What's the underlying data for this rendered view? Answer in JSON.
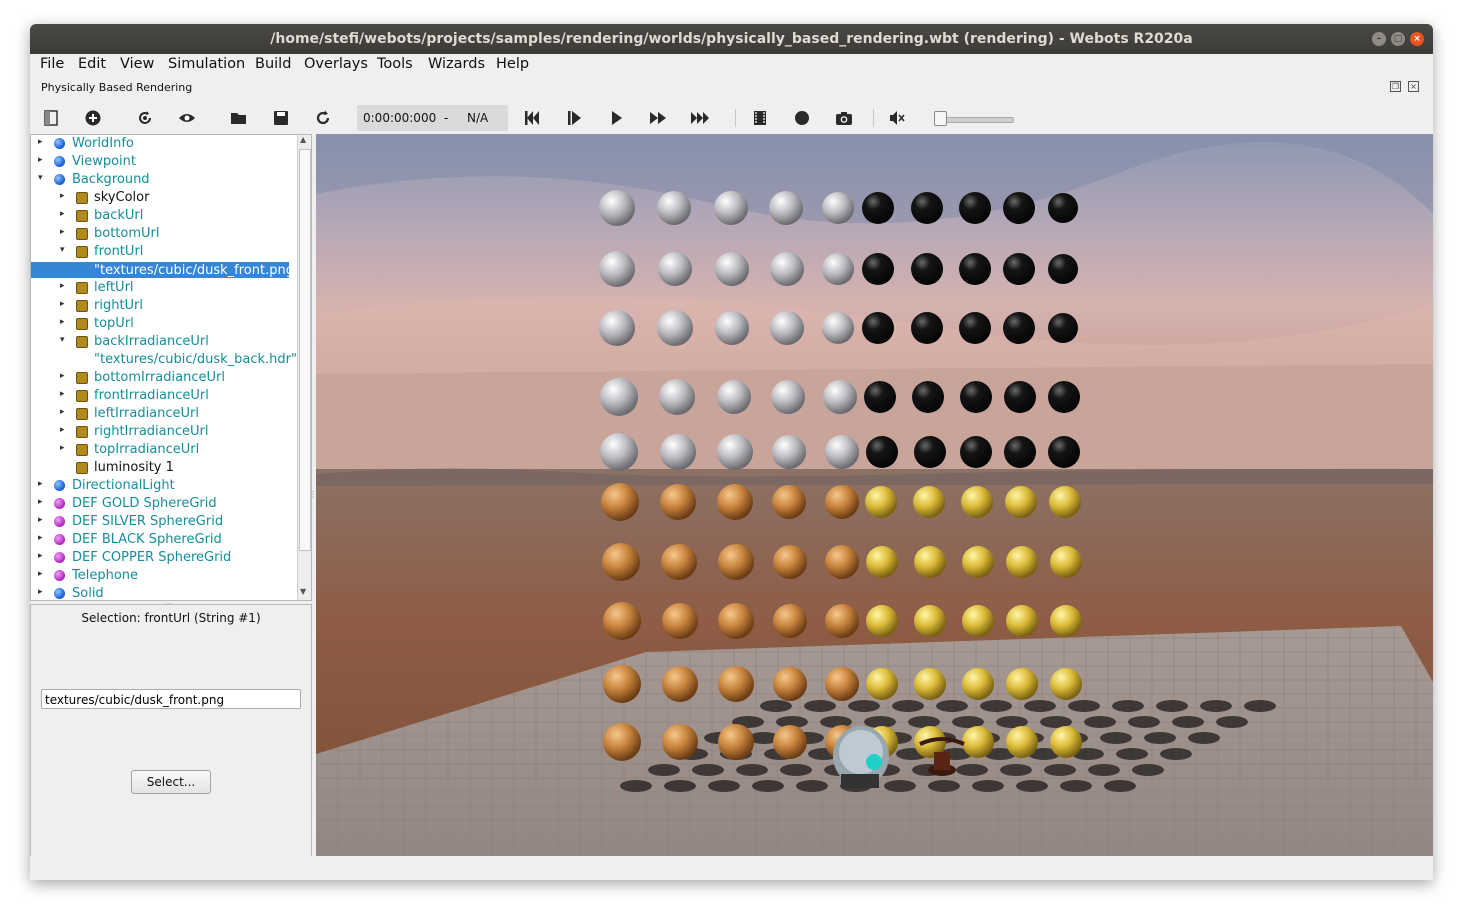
{
  "window": {
    "title": "/home/stefi/webots/projects/samples/rendering/worlds/physically_based_rendering.wbt (rendering) - Webots R2020a"
  },
  "menu": [
    "File",
    "Edit",
    "View",
    "Simulation",
    "Build",
    "Overlays",
    "Tools",
    "Wizards",
    "Help"
  ],
  "dock": {
    "title": "Physically Based Rendering"
  },
  "toolbar": {
    "time": "0:00:00:000",
    "separator": "-",
    "speed": "N/A",
    "volume": 0.05,
    "icons": [
      "scene-tree-toggle-icon",
      "add-node-icon",
      "reload-world-icon",
      "view-icon",
      "open-world-icon",
      "save-world-icon",
      "reset-simulation-icon",
      "reset-time-icon",
      "step-icon",
      "run-icon",
      "fast-icon",
      "fastest-icon",
      "record-movie-icon",
      "record-animation-icon",
      "screenshot-icon",
      "mute-icon"
    ]
  },
  "tree": {
    "nodes": [
      {
        "label": "WorldInfo",
        "kind": "node",
        "arrow": "▸",
        "depth": 0
      },
      {
        "label": "Viewpoint",
        "kind": "node",
        "arrow": "▸",
        "depth": 0
      },
      {
        "label": "Background",
        "kind": "node",
        "arrow": "▾",
        "depth": 0
      },
      {
        "label": "skyColor",
        "kind": "field",
        "arrow": "▸",
        "depth": 1,
        "dark": true
      },
      {
        "label": "backUrl",
        "kind": "field",
        "arrow": "▸",
        "depth": 1
      },
      {
        "label": "bottomUrl",
        "kind": "field",
        "arrow": "▸",
        "depth": 1
      },
      {
        "label": "frontUrl",
        "kind": "field",
        "arrow": "▾",
        "depth": 1
      },
      {
        "label": "\"textures/cubic/dusk_front.png\"",
        "kind": "value",
        "arrow": "",
        "depth": 2,
        "selected": true
      },
      {
        "label": "leftUrl",
        "kind": "field",
        "arrow": "▸",
        "depth": 1
      },
      {
        "label": "rightUrl",
        "kind": "field",
        "arrow": "▸",
        "depth": 1
      },
      {
        "label": "topUrl",
        "kind": "field",
        "arrow": "▸",
        "depth": 1
      },
      {
        "label": "backIrradianceUrl",
        "kind": "field",
        "arrow": "▾",
        "depth": 1
      },
      {
        "label": "\"textures/cubic/dusk_back.hdr\"",
        "kind": "value",
        "arrow": "",
        "depth": 2
      },
      {
        "label": "bottomIrradianceUrl",
        "kind": "field",
        "arrow": "▸",
        "depth": 1
      },
      {
        "label": "frontIrradianceUrl",
        "kind": "field",
        "arrow": "▸",
        "depth": 1
      },
      {
        "label": "leftIrradianceUrl",
        "kind": "field",
        "arrow": "▸",
        "depth": 1
      },
      {
        "label": "rightIrradianceUrl",
        "kind": "field",
        "arrow": "▸",
        "depth": 1
      },
      {
        "label": "topIrradianceUrl",
        "kind": "field",
        "arrow": "▸",
        "depth": 1
      },
      {
        "label": "luminosity 1",
        "kind": "field",
        "arrow": "",
        "depth": 1,
        "dark": true
      },
      {
        "label": "DirectionalLight",
        "kind": "node",
        "arrow": "▸",
        "depth": 0
      },
      {
        "label": "DEF GOLD SphereGrid",
        "kind": "proto",
        "arrow": "▸",
        "depth": 0
      },
      {
        "label": "DEF SILVER SphereGrid",
        "kind": "proto",
        "arrow": "▸",
        "depth": 0
      },
      {
        "label": "DEF BLACK SphereGrid",
        "kind": "proto",
        "arrow": "▸",
        "depth": 0
      },
      {
        "label": "DEF COPPER SphereGrid",
        "kind": "proto",
        "arrow": "▸",
        "depth": 0
      },
      {
        "label": "Telephone",
        "kind": "proto",
        "arrow": "▸",
        "depth": 0
      },
      {
        "label": "Solid",
        "kind": "node",
        "arrow": "▸",
        "depth": 0
      }
    ]
  },
  "editor": {
    "selection": "Selection: frontUrl (String #1)",
    "value": "textures/cubic/dusk_front.png",
    "select_label": "Select..."
  },
  "colors": {
    "title_bar": "#3c3b37",
    "teal_text": "#148d9b",
    "selection": "#3586d6",
    "node_icon": "#1b62d6",
    "proto_icon": "#b52bc4",
    "field_icon": "#b08a1d"
  }
}
